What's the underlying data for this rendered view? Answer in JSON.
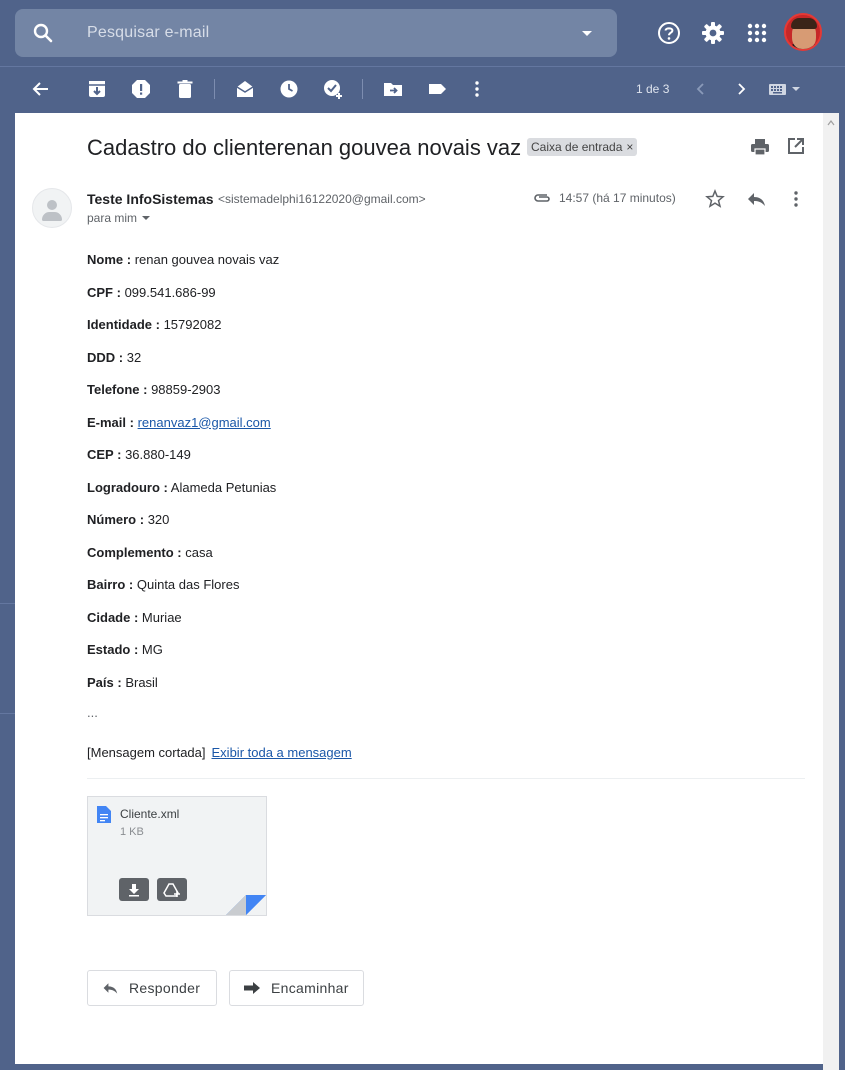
{
  "search": {
    "placeholder": "Pesquisar e-mail"
  },
  "toolbar": {
    "pager": "1 de 3"
  },
  "message": {
    "subject": "Cadastro do clienterenan gouvea novais vaz",
    "label": "Caixa de entrada",
    "label_close": "×",
    "sender_name": "Teste InfoSistemas",
    "sender_email": "<sistemadelphi16122020@gmail.com>",
    "recipient": "para mim",
    "time": "14:57 (há 17 minutos)",
    "fields": [
      {
        "label": "Nome :",
        "value": "renan gouvea novais vaz"
      },
      {
        "label": "CPF :",
        "value": "099.541.686-99"
      },
      {
        "label": "Identidade :",
        "value": "15792082"
      },
      {
        "label": "DDD :",
        "value": "32"
      },
      {
        "label": "Telefone :",
        "value": "98859-2903"
      },
      {
        "label": "E-mail :",
        "value": "renanvaz1@gmail.com",
        "link": true
      },
      {
        "label": "CEP :",
        "value": "36.880-149"
      },
      {
        "label": "Logradouro :",
        "value": "Alameda Petunias"
      },
      {
        "label": "Número :",
        "value": "320"
      },
      {
        "label": "Complemento :",
        "value": "casa"
      },
      {
        "label": "Bairro :",
        "value": "Quinta das Flores"
      },
      {
        "label": "Cidade :",
        "value": "Muriae"
      },
      {
        "label": "Estado :",
        "value": "MG"
      },
      {
        "label": "País :",
        "value": "Brasil"
      }
    ],
    "ellipsis": "...",
    "clipped_notice": "[Mensagem cortada]",
    "view_full": "Exibir toda a mensagem"
  },
  "attachment": {
    "name": "Cliente.xml",
    "size": "1 KB"
  },
  "actions": {
    "reply": "Responder",
    "forward": "Encaminhar"
  },
  "colors": {
    "header_bg": "#50638a",
    "search_bg": "#7385a5",
    "link": "#1a57a8",
    "doc_icon": "#4285f4"
  }
}
